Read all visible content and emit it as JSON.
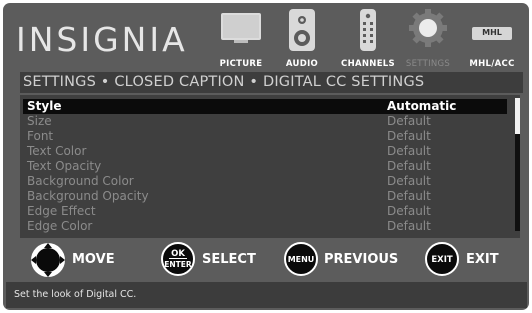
{
  "brand": {
    "logo_text": "INSIGNIA"
  },
  "main_menu": [
    {
      "label": "PICTURE",
      "icon": "tv-icon",
      "active": true
    },
    {
      "label": "AUDIO",
      "icon": "speaker-icon",
      "active": true
    },
    {
      "label": "CHANNELS",
      "icon": "remote-icon",
      "active": true
    },
    {
      "label": "SETTINGS",
      "icon": "gear-icon",
      "active": false
    },
    {
      "label": "MHL/ACC",
      "icon": "mhl-icon",
      "badge": "MHL",
      "active": true
    }
  ],
  "breadcrumb": "SETTINGS • CLOSED CAPTION • DIGITAL CC SETTINGS",
  "settings": [
    {
      "name": "Style",
      "value": "Automatic",
      "selected": true
    },
    {
      "name": "Size",
      "value": "Default",
      "selected": false
    },
    {
      "name": "Font",
      "value": "Default",
      "selected": false
    },
    {
      "name": "Text Color",
      "value": "Default",
      "selected": false
    },
    {
      "name": "Text Opacity",
      "value": "Default",
      "selected": false
    },
    {
      "name": "Background Color",
      "value": "Default",
      "selected": false
    },
    {
      "name": "Background Opacity",
      "value": "Default",
      "selected": false
    },
    {
      "name": "Edge Effect",
      "value": "Default",
      "selected": false
    },
    {
      "name": "Edge Color",
      "value": "Default",
      "selected": false
    }
  ],
  "controls": {
    "move": {
      "label": "MOVE"
    },
    "select": {
      "label": "SELECT",
      "key_top": "OK",
      "key_bottom": "ENTER"
    },
    "previous": {
      "label": "PREVIOUS",
      "key": "MENU"
    },
    "exit": {
      "label": "EXIT",
      "key": "EXIT"
    }
  },
  "help_text": "Set the look of Digital CC.",
  "colors": {
    "panel": "#5c5c5c",
    "list_bg": "#3f3f3f",
    "selected_bg": "#0b0b0b",
    "dim_text": "#8b8b8b"
  }
}
